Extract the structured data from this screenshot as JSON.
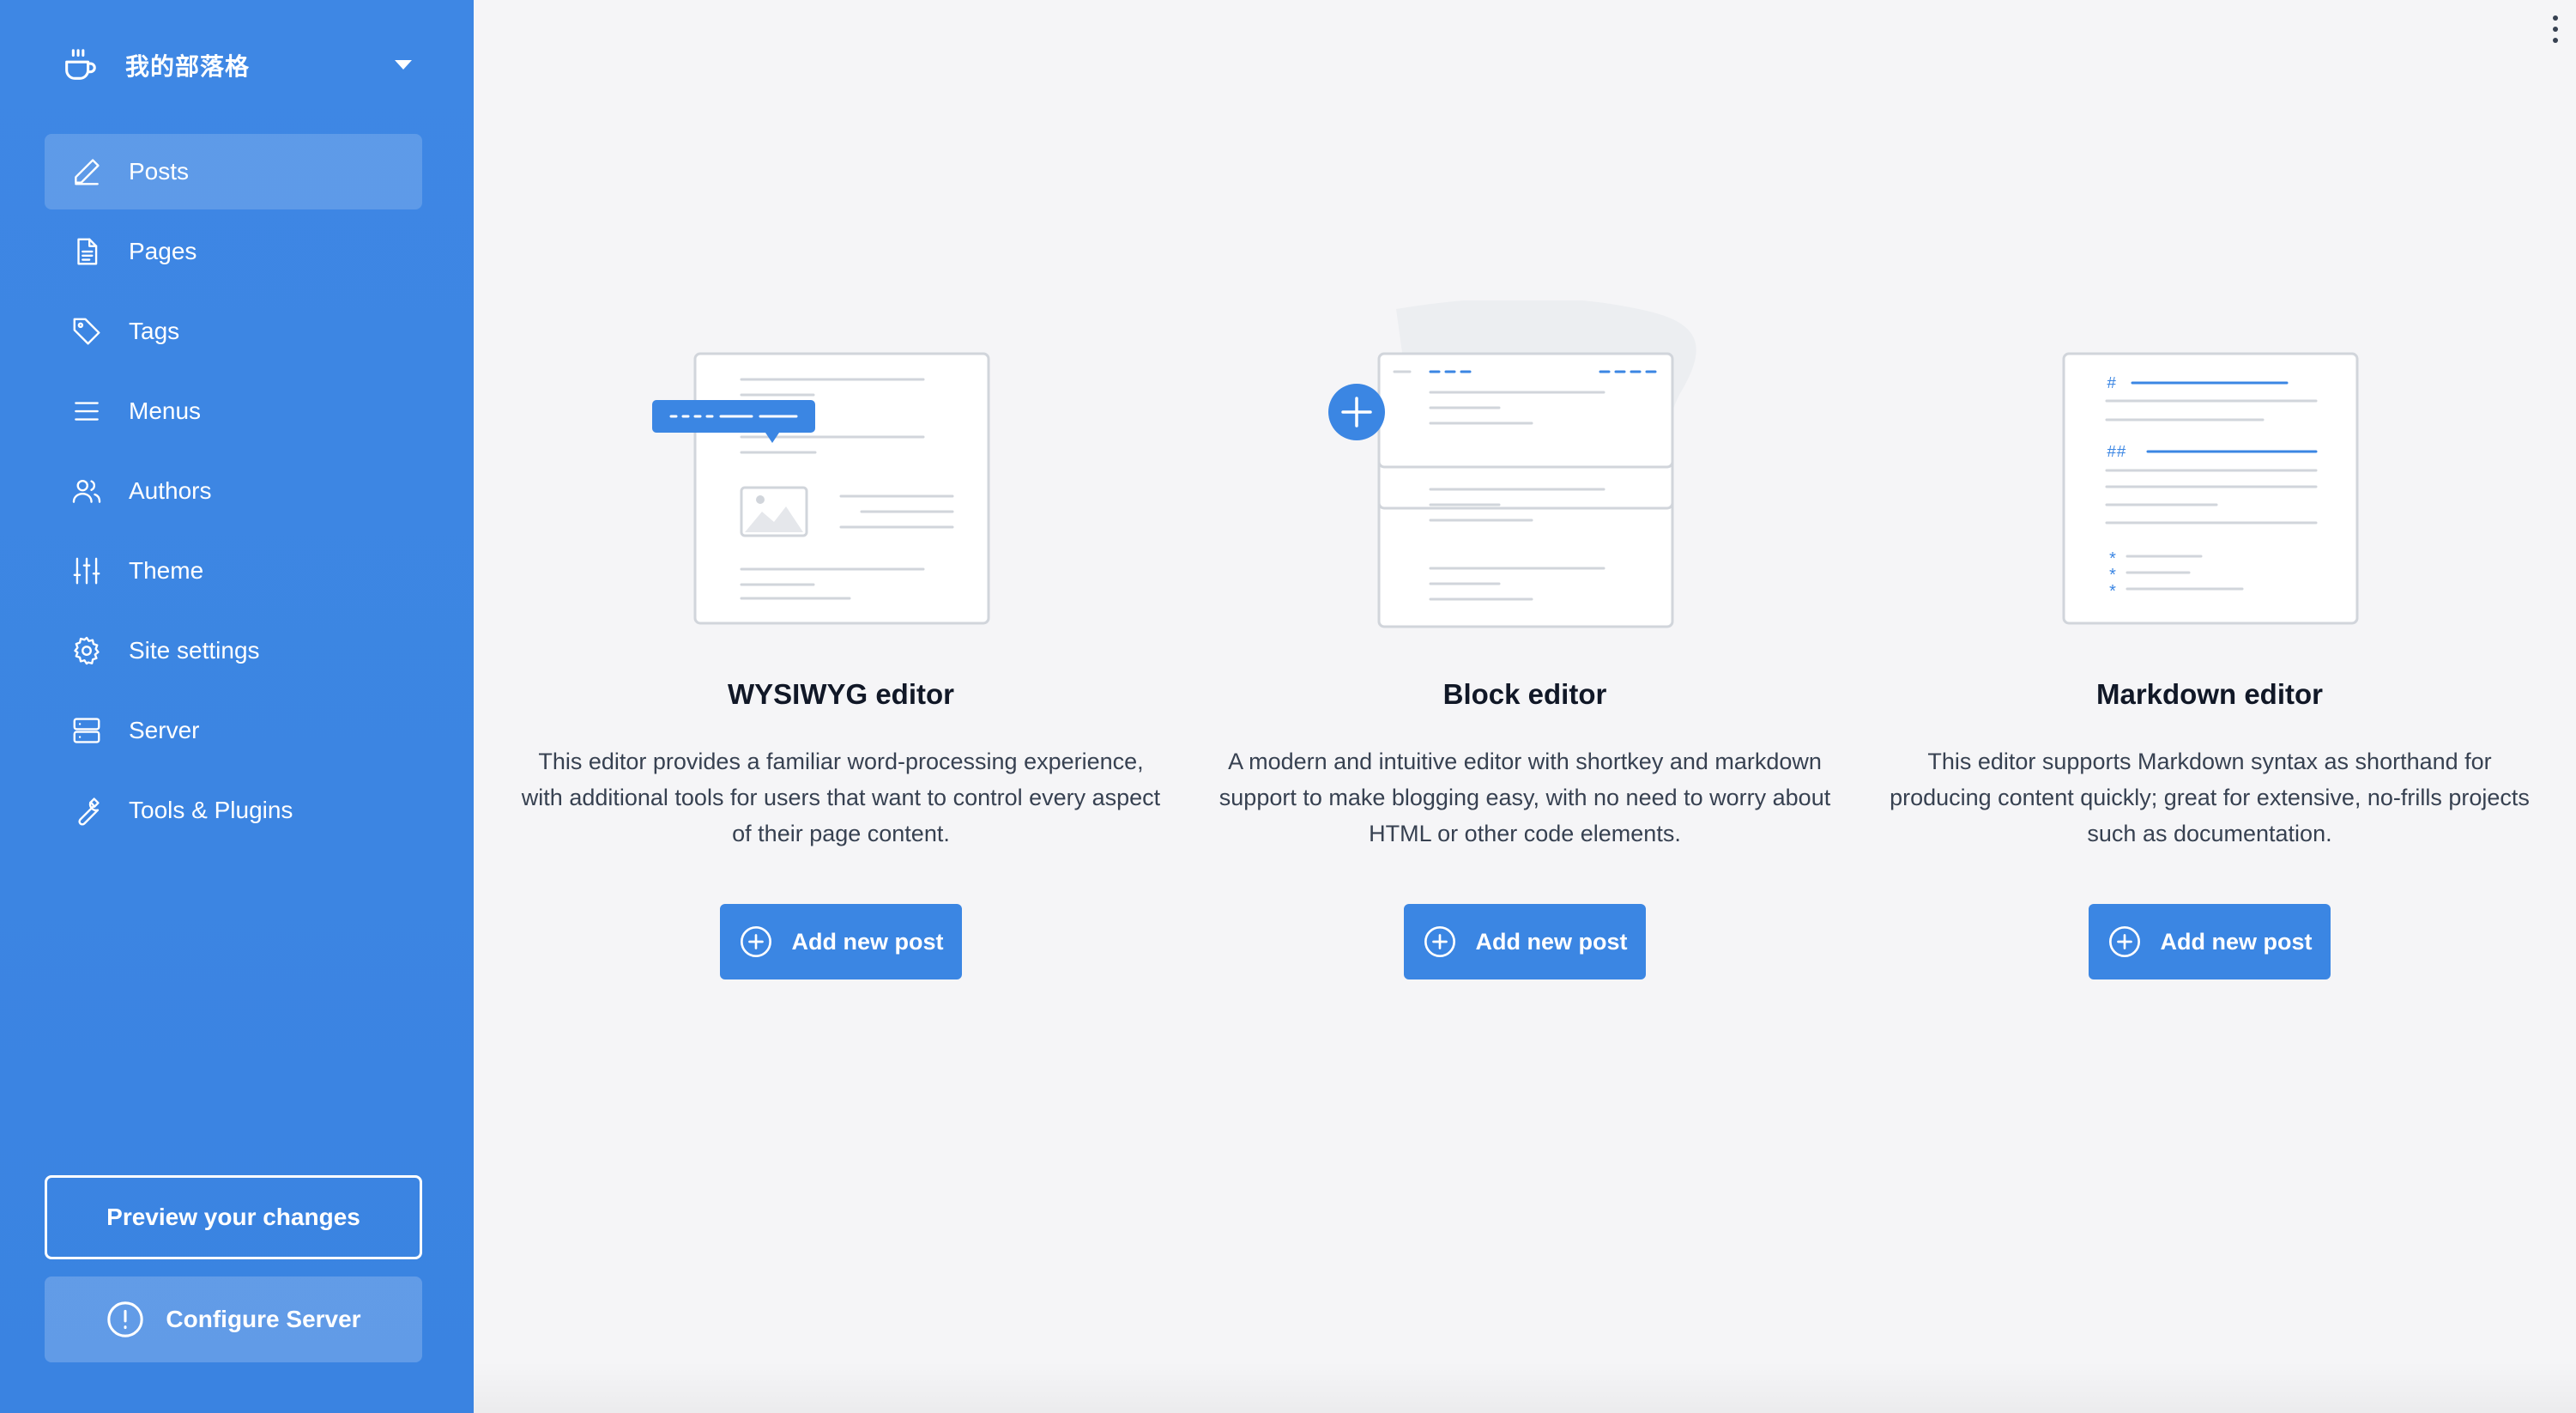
{
  "site": {
    "name": "我的部落格",
    "icon": "coffee-cup-icon"
  },
  "sidebar": {
    "items": [
      {
        "label": "Posts",
        "icon": "pencil-icon",
        "active": true
      },
      {
        "label": "Pages",
        "icon": "document-icon"
      },
      {
        "label": "Tags",
        "icon": "tag-icon"
      },
      {
        "label": "Menus",
        "icon": "menu-lines-icon"
      },
      {
        "label": "Authors",
        "icon": "users-icon"
      },
      {
        "label": "Theme",
        "icon": "sliders-icon"
      },
      {
        "label": "Site settings",
        "icon": "gear-icon"
      },
      {
        "label": "Server",
        "icon": "server-icon"
      },
      {
        "label": "Tools & Plugins",
        "icon": "wrench-icon"
      }
    ],
    "preview_label": "Preview your changes",
    "configure_label": "Configure Server"
  },
  "editors": [
    {
      "title": "WYSIWYG editor",
      "description": "This editor provides a familiar word-processing experience, with additional tools for users that want to control every aspect of their page content.",
      "button_label": "Add new post"
    },
    {
      "title": "Block editor",
      "description": "A modern and intuitive editor with shortkey and markdown support to make blogging easy, with no need to worry about HTML or other code elements.",
      "button_label": "Add new post"
    },
    {
      "title": "Markdown editor",
      "description": "This editor supports Markdown syntax as shorthand for producing content quickly; great for extensive, no-frills projects such as documentation.",
      "button_label": "Add new post"
    }
  ],
  "illustration_text": {
    "md_h1": "#",
    "md_h2": "##",
    "md_bullet": "*"
  },
  "colors": {
    "sidebar": "#3c85e2",
    "accent": "#3b86e3",
    "background": "#f5f5f7"
  }
}
